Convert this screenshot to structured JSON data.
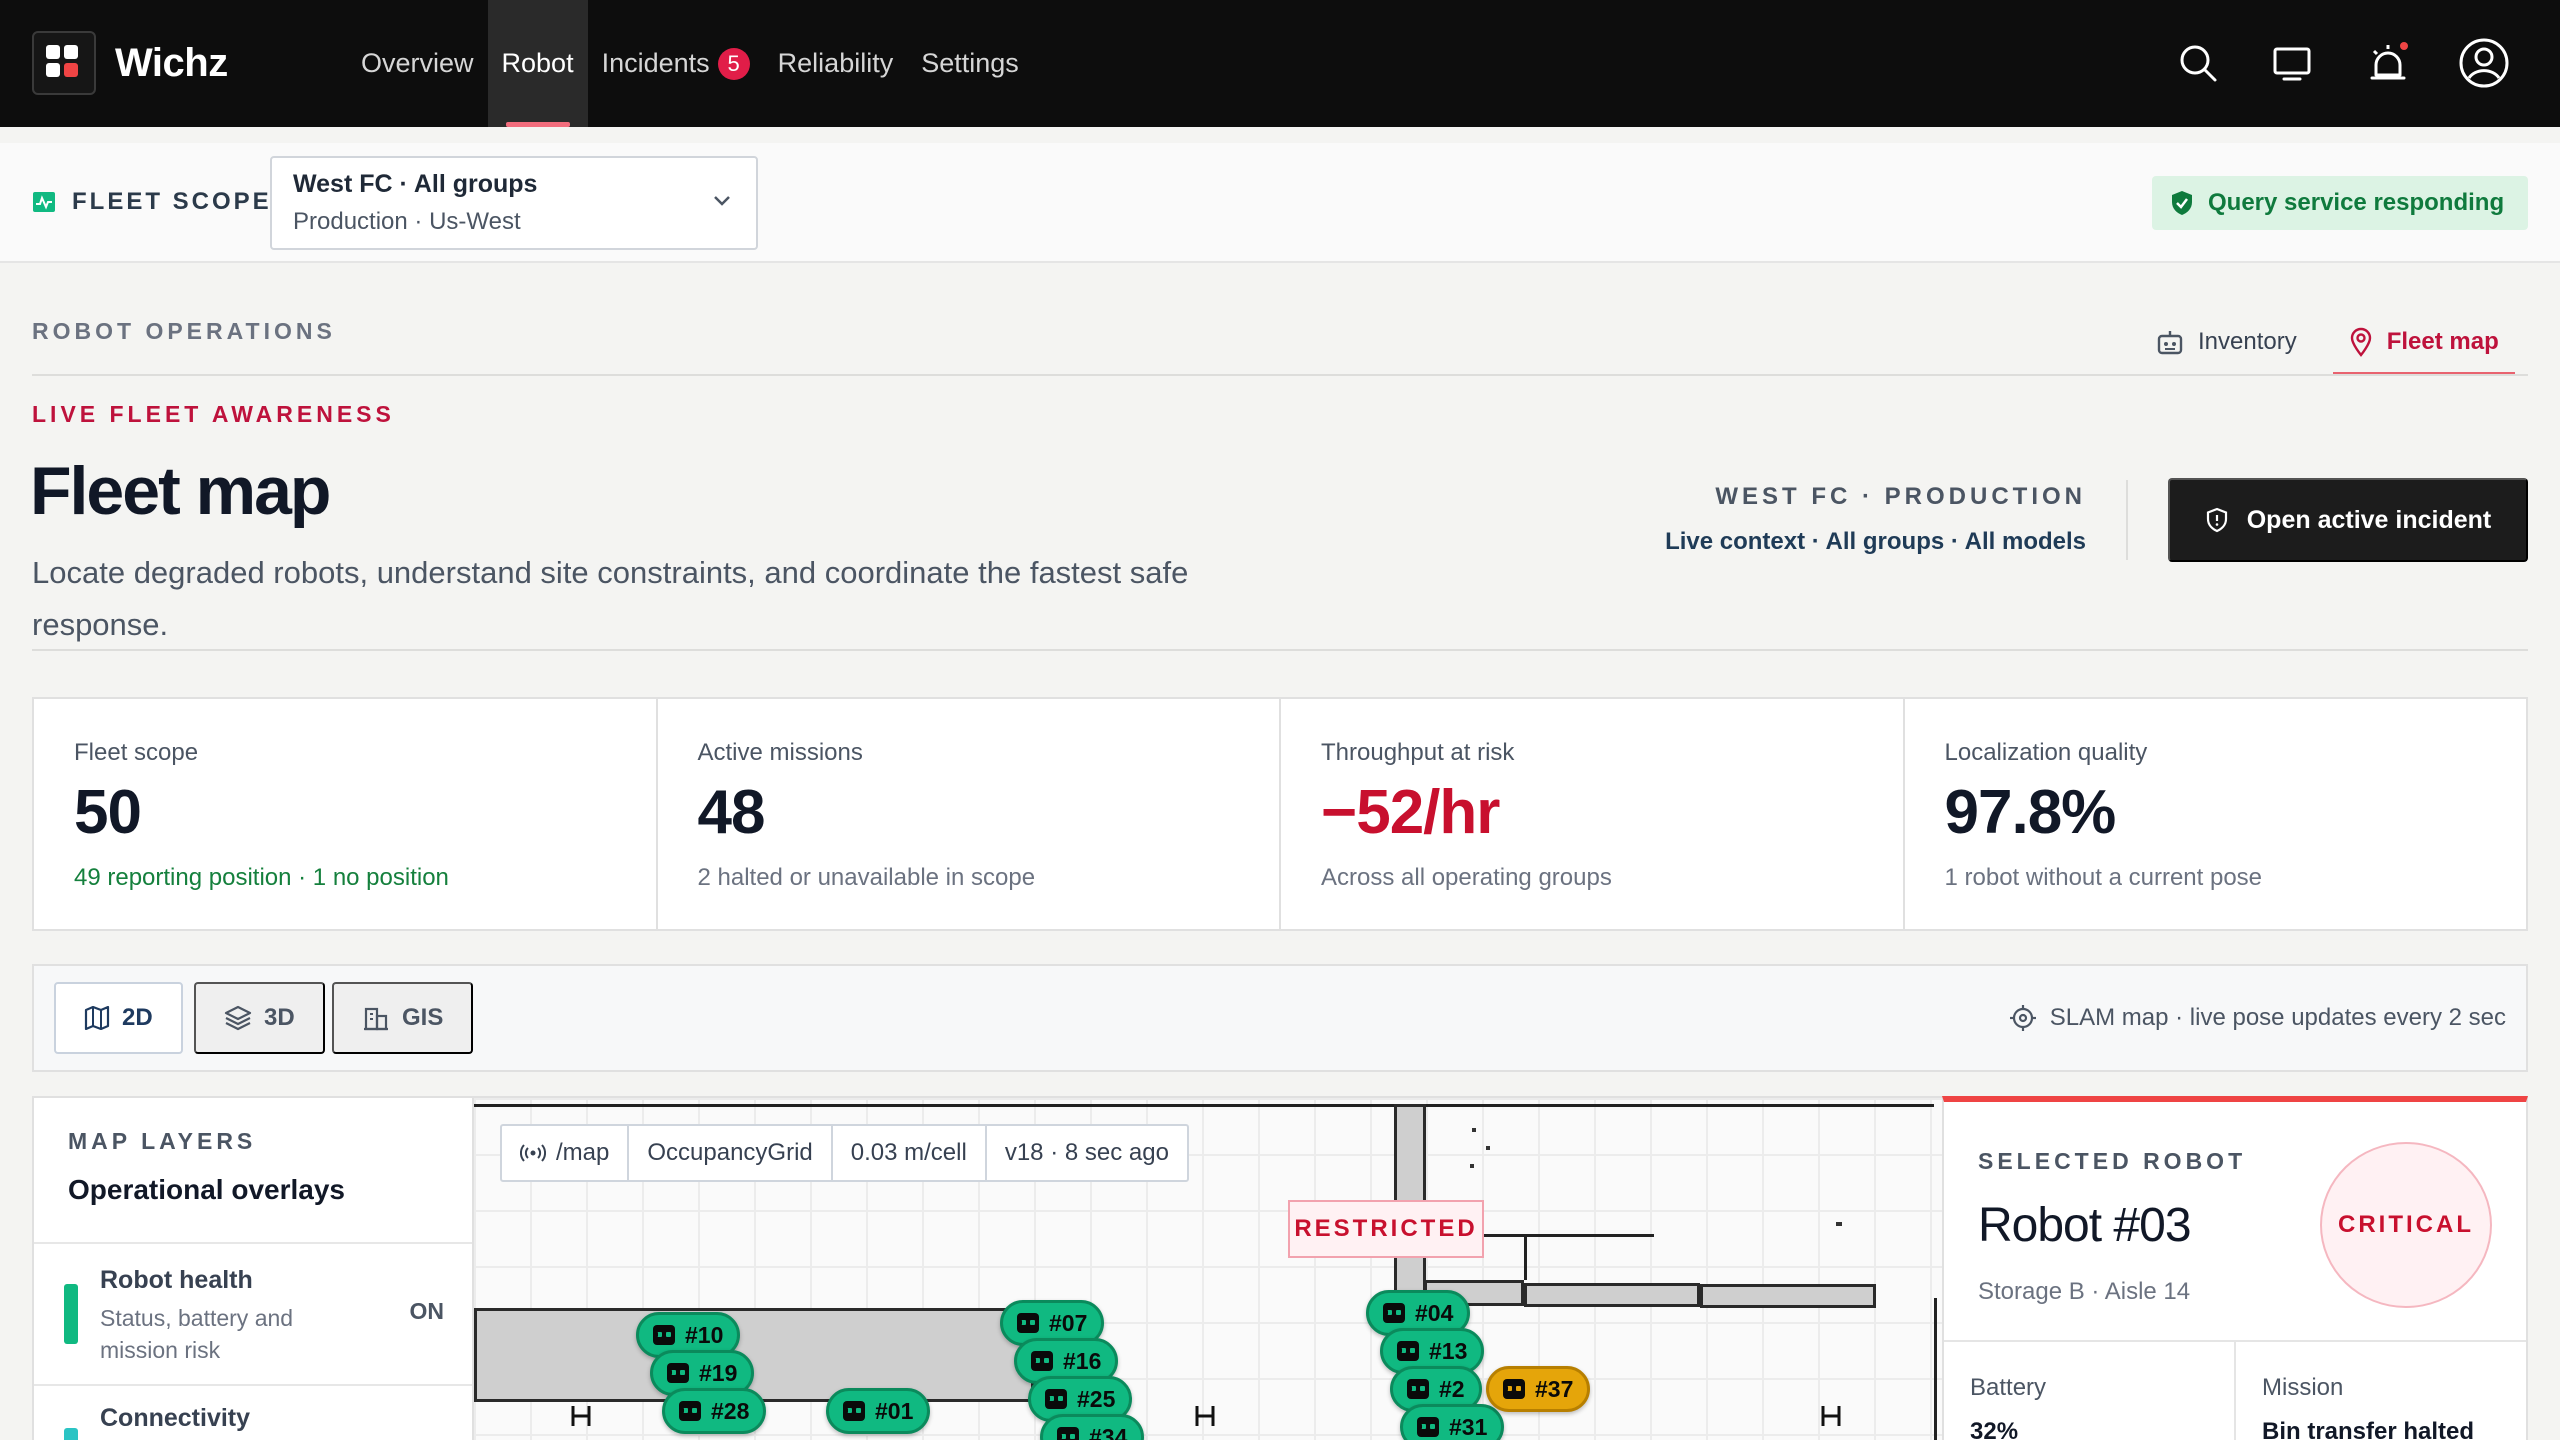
{
  "app": {
    "brand": "Wichz",
    "nav": [
      {
        "label": "Overview"
      },
      {
        "label": "Robot"
      },
      {
        "label": "Incidents",
        "badge": "5"
      },
      {
        "label": "Reliability"
      },
      {
        "label": "Settings"
      }
    ],
    "active_nav": "Robot",
    "icons": [
      "search-icon",
      "monitor-icon",
      "alarm-icon",
      "user-avatar-icon"
    ]
  },
  "scope": {
    "label": "FLEET SCOPE",
    "selected_primary": "West FC · All groups",
    "selected_secondary": "Production · Us-West",
    "status": "Query service responding"
  },
  "page": {
    "section": "ROBOT OPERATIONS",
    "tabs": [
      {
        "label": "Inventory",
        "icon": "robot-icon"
      },
      {
        "label": "Fleet map",
        "icon": "map-pin-icon",
        "active": true
      }
    ],
    "eyebrow": "LIVE FLEET AWARENESS",
    "title": "Fleet map",
    "subtitle": "Locate degraded robots, understand site constraints, and coordinate the fastest safe response.",
    "context_title": "WEST FC · PRODUCTION",
    "context_sub": "Live context · All groups · All models",
    "incident_button": "Open active incident"
  },
  "kpis": [
    {
      "label": "Fleet scope",
      "value": "50",
      "note": "49 reporting position · 1 no position",
      "tone": "green"
    },
    {
      "label": "Active missions",
      "value": "48",
      "note": "2 halted or unavailable in scope",
      "tone": "neutral"
    },
    {
      "label": "Throughput at risk",
      "value": "−52/hr",
      "note": "Across all operating groups",
      "tone": "red"
    },
    {
      "label": "Localization quality",
      "value": "97.8%",
      "note": "1 robot without a current pose",
      "tone": "neutral"
    }
  ],
  "views": {
    "modes": [
      {
        "label": "2D",
        "icon": "map-icon",
        "active": true
      },
      {
        "label": "3D",
        "icon": "layers-icon"
      },
      {
        "label": "GIS",
        "icon": "building-icon"
      }
    ],
    "note": "SLAM map · live pose updates every 2 sec"
  },
  "layers": {
    "eyebrow": "MAP LAYERS",
    "title": "Operational overlays",
    "items": [
      {
        "name": "Robot health",
        "desc": "Status, battery and mission risk",
        "state": "ON",
        "color": "#10b981"
      },
      {
        "name": "Connectivity",
        "desc": "",
        "state": "",
        "color": "#2bc4c4"
      }
    ]
  },
  "map": {
    "topic": "/map",
    "type": "OccupancyGrid",
    "resolution": "0.03 m/cell",
    "version": "v18 · 8 sec ago",
    "restricted_label": "RESTRICTED",
    "robots": [
      {
        "label": "#10",
        "status": "ok"
      },
      {
        "label": "#19",
        "status": "ok"
      },
      {
        "label": "#28",
        "status": "ok"
      },
      {
        "label": "#01",
        "status": "ok"
      },
      {
        "label": "#07",
        "status": "ok"
      },
      {
        "label": "#16",
        "status": "ok"
      },
      {
        "label": "#25",
        "status": "ok"
      },
      {
        "label": "#34",
        "status": "ok"
      },
      {
        "label": "#04",
        "status": "ok"
      },
      {
        "label": "#13",
        "status": "ok"
      },
      {
        "label": "#2",
        "status": "ok"
      },
      {
        "label": "#31",
        "status": "ok"
      },
      {
        "label": "#37",
        "status": "warning"
      }
    ]
  },
  "selected_robot": {
    "eyebrow": "SELECTED ROBOT",
    "name": "Robot #03",
    "location": "Storage B · Aisle 14",
    "severity": "CRITICAL",
    "battery_label": "Battery",
    "battery_value": "32%",
    "mission_label": "Mission",
    "mission_value": "Bin transfer halted"
  },
  "colors": {
    "accent": "#e8626f",
    "critical": "#c8102e",
    "ok_robot": "#10b981",
    "warn_robot": "#e5a50a",
    "status_ok": "#0f7a3d"
  }
}
